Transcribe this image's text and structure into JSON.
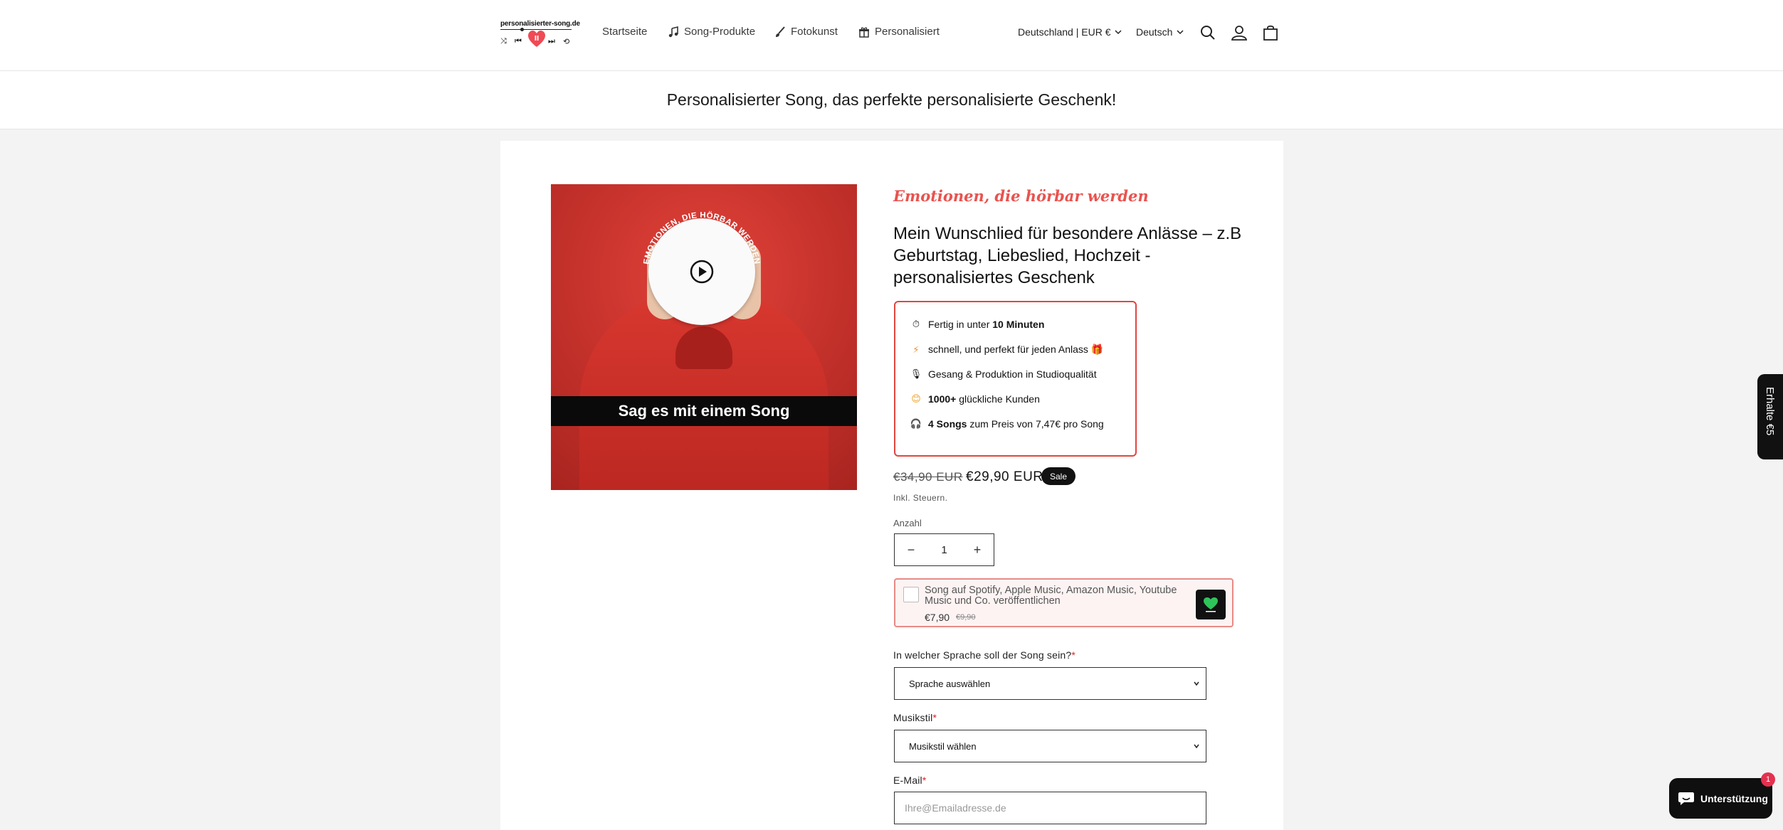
{
  "header": {
    "logo_text": "personalisierter-song.de",
    "nav": [
      {
        "label": "Startseite",
        "icon": ""
      },
      {
        "label": "Song-Produkte",
        "icon": "music-note-icon"
      },
      {
        "label": "Fotokunst",
        "icon": "brush-icon"
      },
      {
        "label": "Personalisiert",
        "icon": "gift-icon"
      }
    ],
    "country": "Deutschland | EUR €",
    "language": "Deutsch"
  },
  "announcement": "Personalisierter Song, das perfekte personalisierte Geschenk!",
  "media": {
    "curved_text": "EMOTIONEN, DIE HÖRBAR WERDEN",
    "banner": "Sag es mit einem Song"
  },
  "product": {
    "tagline": "Emotionen, die hörbar werden",
    "title": "Mein Wunschlied für besondere Anlässe – z.B Geburtstag, Liebeslied, Hochzeit - personalisiertes Geschenk",
    "features": [
      {
        "icon": "stopwatch-icon",
        "pre": "Fertig in unter ",
        "bold": "10 Minuten",
        "post": ""
      },
      {
        "icon": "lightning-icon",
        "pre": "schnell, und perfekt für jeden Anlass ",
        "bold": "",
        "post": "🎁"
      },
      {
        "icon": "microphone-icon",
        "pre": "Gesang & Produktion in Studioqualität",
        "bold": "",
        "post": ""
      },
      {
        "icon": "smiley-icon",
        "pre": "",
        "bold": "1000+",
        "post": " glückliche Kunden"
      },
      {
        "icon": "headphones-icon",
        "pre": "",
        "bold": "4 Songs",
        "post": " zum Preis von 7,47€ pro Song"
      }
    ],
    "price_old": "€34,90 EUR",
    "price_new": "€29,90 EUR",
    "sale_badge": "Sale",
    "tax_note": "Inkl. Steuern.",
    "quantity_label": "Anzahl",
    "quantity": "1",
    "upsell": {
      "text": "Song auf Spotify, Apple Music, Amazon Music, Youtube Music und Co. veröffentlichen",
      "price": "€7,90",
      "old_price": "€9,90"
    },
    "fields": {
      "language_label": "In welcher Sprache soll der Song sein?",
      "language_placeholder": "Sprache auswählen",
      "style_label": "Musikstil",
      "style_placeholder": "Musikstil wählen",
      "email_label": "E-Mail",
      "email_placeholder": "Ihre@Emailadresse.de",
      "required_mark": "*"
    }
  },
  "floating": {
    "side_tab": "Erhalte €5",
    "support": "Unterstützung",
    "support_badge": "1"
  },
  "colors": {
    "accent": "#e0463f",
    "tagline": "#e8534f",
    "dark": "#121212"
  }
}
